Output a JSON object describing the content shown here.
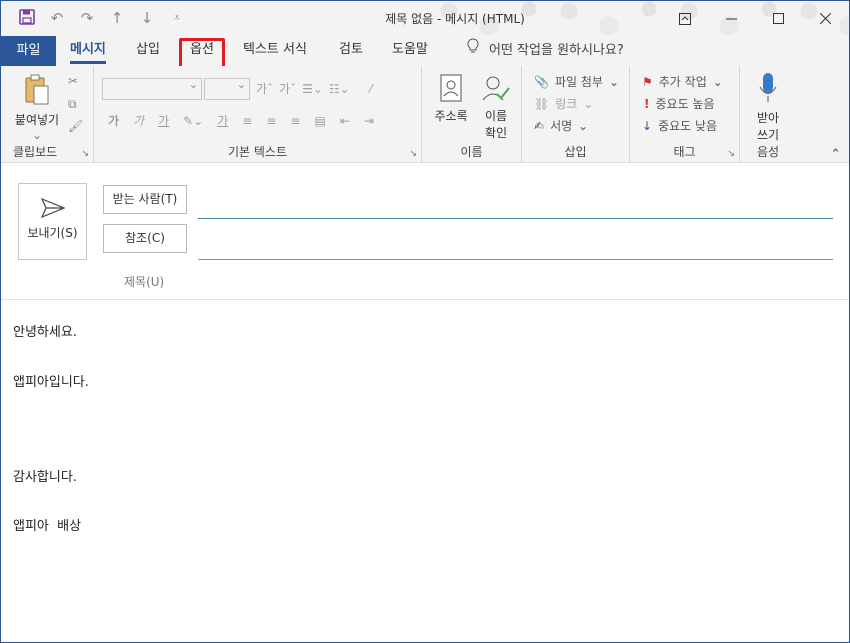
{
  "window": {
    "title": "제목 없음 - 메시지 (HTML)"
  },
  "tabs": {
    "file": "파일",
    "items": [
      "메시지",
      "삽입",
      "옵션",
      "텍스트 서식",
      "검토",
      "도움말"
    ],
    "tell_me": "어떤 작업을 원하시나요?"
  },
  "ribbon": {
    "clipboard": {
      "paste": "붙여넣기",
      "label": "클립보드"
    },
    "basic_text": {
      "label": "기본 텍스트",
      "bold": "가",
      "italic": "가",
      "underline": "가",
      "highlight": "가",
      "font_color": "가"
    },
    "names": {
      "address_book": "주소록",
      "check_names_1": "이름",
      "check_names_2": "확인",
      "label": "이름"
    },
    "insert": {
      "attach": "파일 첨부",
      "link": "링크",
      "signature": "서명",
      "label": "삽입"
    },
    "tags": {
      "follow_up": "추가 작업",
      "high": "중요도 높음",
      "low": "중요도 낮음",
      "label": "태그"
    },
    "voice": {
      "dictate_1": "받아",
      "dictate_2": "쓰기",
      "label": "음성"
    }
  },
  "compose": {
    "send": "보내기(S)",
    "to": "받는 사람(T)",
    "cc": "참조(C)",
    "subject": "제목(U)"
  },
  "body": {
    "lines": [
      "안녕하세요.",
      "앱피아입니다.",
      "감사합니다.",
      "앱피아  배상"
    ]
  },
  "colors": {
    "accent": "#2b579a",
    "highlight_box": "#e31b23",
    "to_underline": "#4a7f9b"
  }
}
